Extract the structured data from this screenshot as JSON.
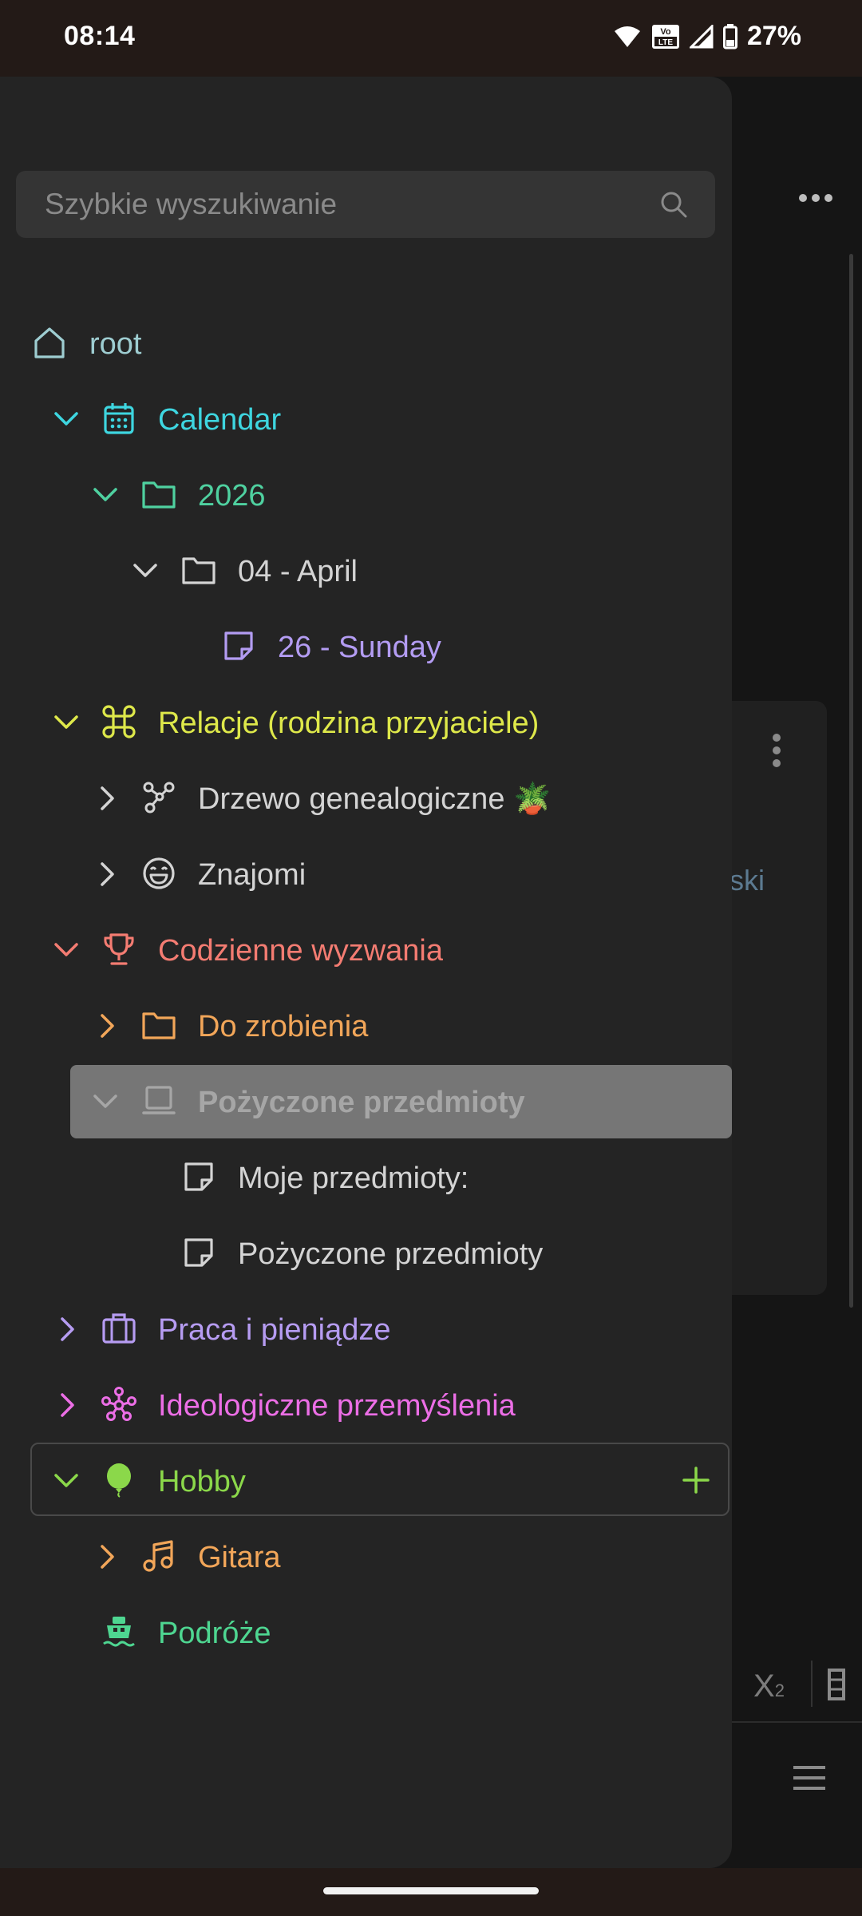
{
  "status_bar": {
    "time": "08:14",
    "battery": "27%",
    "volte_top": "Vo",
    "volte_bottom": "LTE"
  },
  "search": {
    "placeholder": "Szybkie wyszukiwanie"
  },
  "tree": {
    "root": "root",
    "calendar": "Calendar",
    "year": "2026",
    "month": "04 - April",
    "day": "26 - Sunday",
    "relations": "Relacje (rodzina przyjaciele)",
    "family_tree": "Drzewo genealogiczne 🪴",
    "acquaintances": "Znajomi",
    "challenges": "Codzienne wyzwania",
    "todo": "Do zrobienia",
    "borrowed_folder": "Pożyczone przedmioty",
    "my_items": "Moje przedmioty:",
    "borrowed_note": "Pożyczone przedmioty",
    "work_money": "Praca i pieniądze",
    "ideology": "Ideologiczne przemyślenia",
    "hobby": "Hobby",
    "guitar": "Gitara",
    "travel": "Podróże"
  },
  "background": {
    "partial_text": "ski",
    "subscript_glyph": "X",
    "subscript_index": "2"
  },
  "colors": {
    "root": "#9ecdd1",
    "calendar": "#3ed6e0",
    "year": "#4fd1a0",
    "neutral": "#d4d4d4",
    "day": "#b39cf2",
    "relations": "#dee84a",
    "challenges": "#f47c72",
    "todo": "#f2a659",
    "selected_text": "#a6a6a6",
    "work": "#b69cf2",
    "ideology": "#ec6ee6",
    "hobby": "#8bd84a",
    "guitar": "#f2a659",
    "travel": "#4ed691"
  }
}
